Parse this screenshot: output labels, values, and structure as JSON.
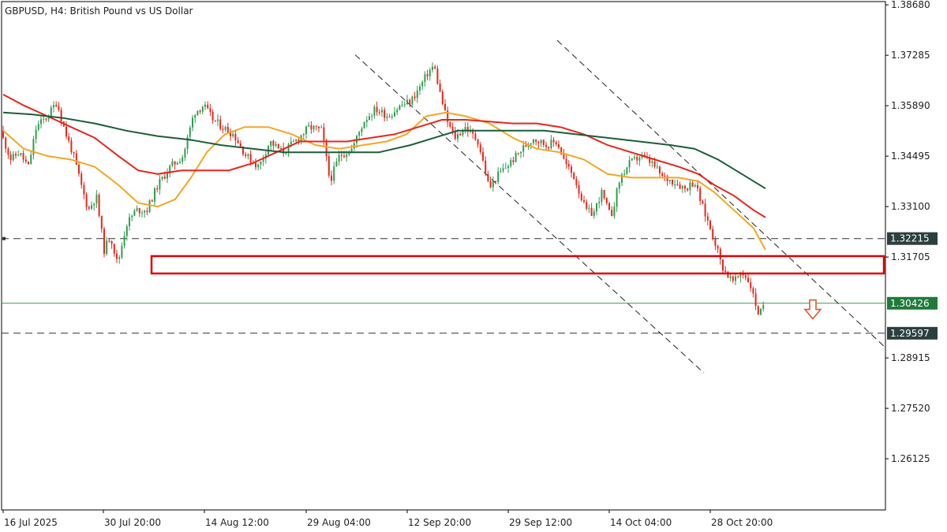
{
  "chart_data": {
    "type": "candlestick",
    "title": "GBPUSD, H4:  British Pound vs US Dollar",
    "y_ticks": [
      "1.38680",
      "1.37285",
      "1.35890",
      "1.34495",
      "1.33100",
      "1.31705",
      "1.28915",
      "1.27520",
      "1.26125"
    ],
    "ylim": [
      1.2471,
      1.3877
    ],
    "x_ticks": [
      "16 Jul 2025",
      "30 Jul 20:00",
      "14 Aug 12:00",
      "29 Aug 04:00",
      "12 Sep 20:00",
      "29 Sep 12:00",
      "14 Oct 04:00",
      "28 Oct 20:00"
    ],
    "price_path": [
      [
        0,
        1.352
      ],
      [
        14,
        1.344
      ],
      [
        24,
        1.346
      ],
      [
        36,
        1.342
      ],
      [
        46,
        1.353
      ],
      [
        60,
        1.356
      ],
      [
        72,
        1.36
      ],
      [
        82,
        1.352
      ],
      [
        92,
        1.346
      ],
      [
        104,
        1.336
      ],
      [
        112,
        1.33
      ],
      [
        122,
        1.334
      ],
      [
        132,
        1.319
      ],
      [
        140,
        1.323
      ],
      [
        149,
        1.315
      ],
      [
        160,
        1.326
      ],
      [
        172,
        1.33
      ],
      [
        186,
        1.33
      ],
      [
        200,
        1.337
      ],
      [
        216,
        1.342
      ],
      [
        232,
        1.345
      ],
      [
        246,
        1.357
      ],
      [
        258,
        1.359
      ],
      [
        270,
        1.355
      ],
      [
        282,
        1.353
      ],
      [
        296,
        1.351
      ],
      [
        312,
        1.345
      ],
      [
        328,
        1.342
      ],
      [
        342,
        1.349
      ],
      [
        358,
        1.346
      ],
      [
        374,
        1.349
      ],
      [
        392,
        1.353
      ],
      [
        408,
        1.352
      ],
      [
        418,
        1.338
      ],
      [
        430,
        1.345
      ],
      [
        446,
        1.347
      ],
      [
        462,
        1.355
      ],
      [
        476,
        1.358
      ],
      [
        492,
        1.356
      ],
      [
        508,
        1.359
      ],
      [
        520,
        1.36
      ],
      [
        532,
        1.364
      ],
      [
        542,
        1.368
      ],
      [
        550,
        1.37
      ],
      [
        558,
        1.362
      ],
      [
        566,
        1.355
      ],
      [
        576,
        1.35
      ],
      [
        590,
        1.353
      ],
      [
        606,
        1.349
      ],
      [
        620,
        1.336
      ],
      [
        632,
        1.34
      ],
      [
        646,
        1.343
      ],
      [
        662,
        1.347
      ],
      [
        676,
        1.35
      ],
      [
        692,
        1.348
      ],
      [
        706,
        1.349
      ],
      [
        716,
        1.343
      ],
      [
        728,
        1.339
      ],
      [
        742,
        1.33
      ],
      [
        752,
        1.329
      ],
      [
        762,
        1.335
      ],
      [
        774,
        1.328
      ],
      [
        786,
        1.339
      ],
      [
        798,
        1.343
      ],
      [
        812,
        1.345
      ],
      [
        826,
        1.343
      ],
      [
        840,
        1.339
      ],
      [
        854,
        1.338
      ],
      [
        868,
        1.336
      ],
      [
        880,
        1.338
      ],
      [
        890,
        1.331
      ],
      [
        900,
        1.325
      ],
      [
        908,
        1.32
      ],
      [
        914,
        1.315
      ],
      [
        922,
        1.312
      ],
      [
        930,
        1.31
      ],
      [
        940,
        1.313
      ],
      [
        950,
        1.31
      ],
      [
        956,
        1.305
      ],
      [
        962,
        1.301
      ],
      [
        970,
        1.304
      ]
    ],
    "moving_averages": [
      {
        "color": "#f5a623",
        "points": [
          [
            4,
            1.352
          ],
          [
            30,
            1.347
          ],
          [
            60,
            1.345
          ],
          [
            90,
            1.344
          ],
          [
            120,
            1.342
          ],
          [
            150,
            1.337
          ],
          [
            175,
            1.332
          ],
          [
            200,
            1.331
          ],
          [
            222,
            1.333
          ],
          [
            242,
            1.339
          ],
          [
            262,
            1.346
          ],
          [
            285,
            1.351
          ],
          [
            310,
            1.353
          ],
          [
            340,
            1.353
          ],
          [
            370,
            1.351
          ],
          [
            400,
            1.348
          ],
          [
            430,
            1.347
          ],
          [
            460,
            1.348
          ],
          [
            490,
            1.349
          ],
          [
            515,
            1.351
          ],
          [
            540,
            1.356
          ],
          [
            565,
            1.357
          ],
          [
            590,
            1.356
          ],
          [
            620,
            1.354
          ],
          [
            650,
            1.35
          ],
          [
            680,
            1.347
          ],
          [
            710,
            1.346
          ],
          [
            740,
            1.344
          ],
          [
            770,
            1.34
          ],
          [
            800,
            1.339
          ],
          [
            830,
            1.339
          ],
          [
            860,
            1.339
          ],
          [
            885,
            1.338
          ],
          [
            905,
            1.335
          ],
          [
            930,
            1.33
          ],
          [
            955,
            1.325
          ],
          [
            970,
            1.319
          ]
        ]
      },
      {
        "color": "#e8261b",
        "points": [
          [
            4,
            1.362
          ],
          [
            30,
            1.359
          ],
          [
            60,
            1.356
          ],
          [
            90,
            1.353
          ],
          [
            120,
            1.35
          ],
          [
            150,
            1.345
          ],
          [
            175,
            1.341
          ],
          [
            200,
            1.34
          ],
          [
            230,
            1.341
          ],
          [
            260,
            1.341
          ],
          [
            290,
            1.341
          ],
          [
            320,
            1.343
          ],
          [
            350,
            1.346
          ],
          [
            380,
            1.349
          ],
          [
            410,
            1.349
          ],
          [
            440,
            1.349
          ],
          [
            470,
            1.35
          ],
          [
            500,
            1.351
          ],
          [
            530,
            1.353
          ],
          [
            560,
            1.355
          ],
          [
            590,
            1.355
          ],
          [
            620,
            1.3545
          ],
          [
            650,
            1.354
          ],
          [
            680,
            1.354
          ],
          [
            710,
            1.353
          ],
          [
            740,
            1.351
          ],
          [
            770,
            1.348
          ],
          [
            800,
            1.346
          ],
          [
            830,
            1.344
          ],
          [
            860,
            1.342
          ],
          [
            885,
            1.34
          ],
          [
            905,
            1.337
          ],
          [
            930,
            1.334
          ],
          [
            955,
            1.33
          ],
          [
            970,
            1.328
          ]
        ]
      },
      {
        "color": "#1b5e3a",
        "points": [
          [
            4,
            1.357
          ],
          [
            40,
            1.3565
          ],
          [
            80,
            1.3555
          ],
          [
            120,
            1.354
          ],
          [
            160,
            1.352
          ],
          [
            200,
            1.3505
          ],
          [
            240,
            1.3495
          ],
          [
            280,
            1.348
          ],
          [
            320,
            1.347
          ],
          [
            360,
            1.346
          ],
          [
            400,
            1.346
          ],
          [
            440,
            1.346
          ],
          [
            480,
            1.346
          ],
          [
            520,
            1.348
          ],
          [
            550,
            1.35
          ],
          [
            580,
            1.352
          ],
          [
            610,
            1.352
          ],
          [
            650,
            1.352
          ],
          [
            690,
            1.352
          ],
          [
            730,
            1.351
          ],
          [
            770,
            1.35
          ],
          [
            810,
            1.349
          ],
          [
            850,
            1.348
          ],
          [
            880,
            1.347
          ],
          [
            910,
            1.344
          ],
          [
            940,
            1.34
          ],
          [
            970,
            1.336
          ]
        ]
      }
    ],
    "channel_lines": [
      {
        "from": [
          450,
          1.373
        ],
        "to": [
          892,
          1.285
        ]
      },
      {
        "from": [
          706,
          1.377
        ],
        "to": [
          1122,
          1.292
        ]
      }
    ],
    "horizontal_levels": [
      {
        "value": 1.32215,
        "label": "1.32215",
        "style": "dashed",
        "tag_color": "#2b3f3f"
      },
      {
        "value": 1.30426,
        "label": "1.30426",
        "style": "solid-green",
        "tag_color": "#1f7a3a"
      },
      {
        "value": 1.29597,
        "label": "1.29597",
        "style": "dashed",
        "tag_color": "#2b3f3f"
      }
    ],
    "resistance_zone": {
      "x_start": 192,
      "x_end": 1122,
      "high": 1.3173,
      "low": 1.3125,
      "color": "#e10000"
    },
    "arrow": {
      "direction": "down",
      "x": 1030,
      "price": 1.303,
      "color": "#e05a2a"
    },
    "colors": {
      "bull": "#2e9e4f",
      "bear": "#e8261b",
      "grid": "#888888"
    }
  }
}
